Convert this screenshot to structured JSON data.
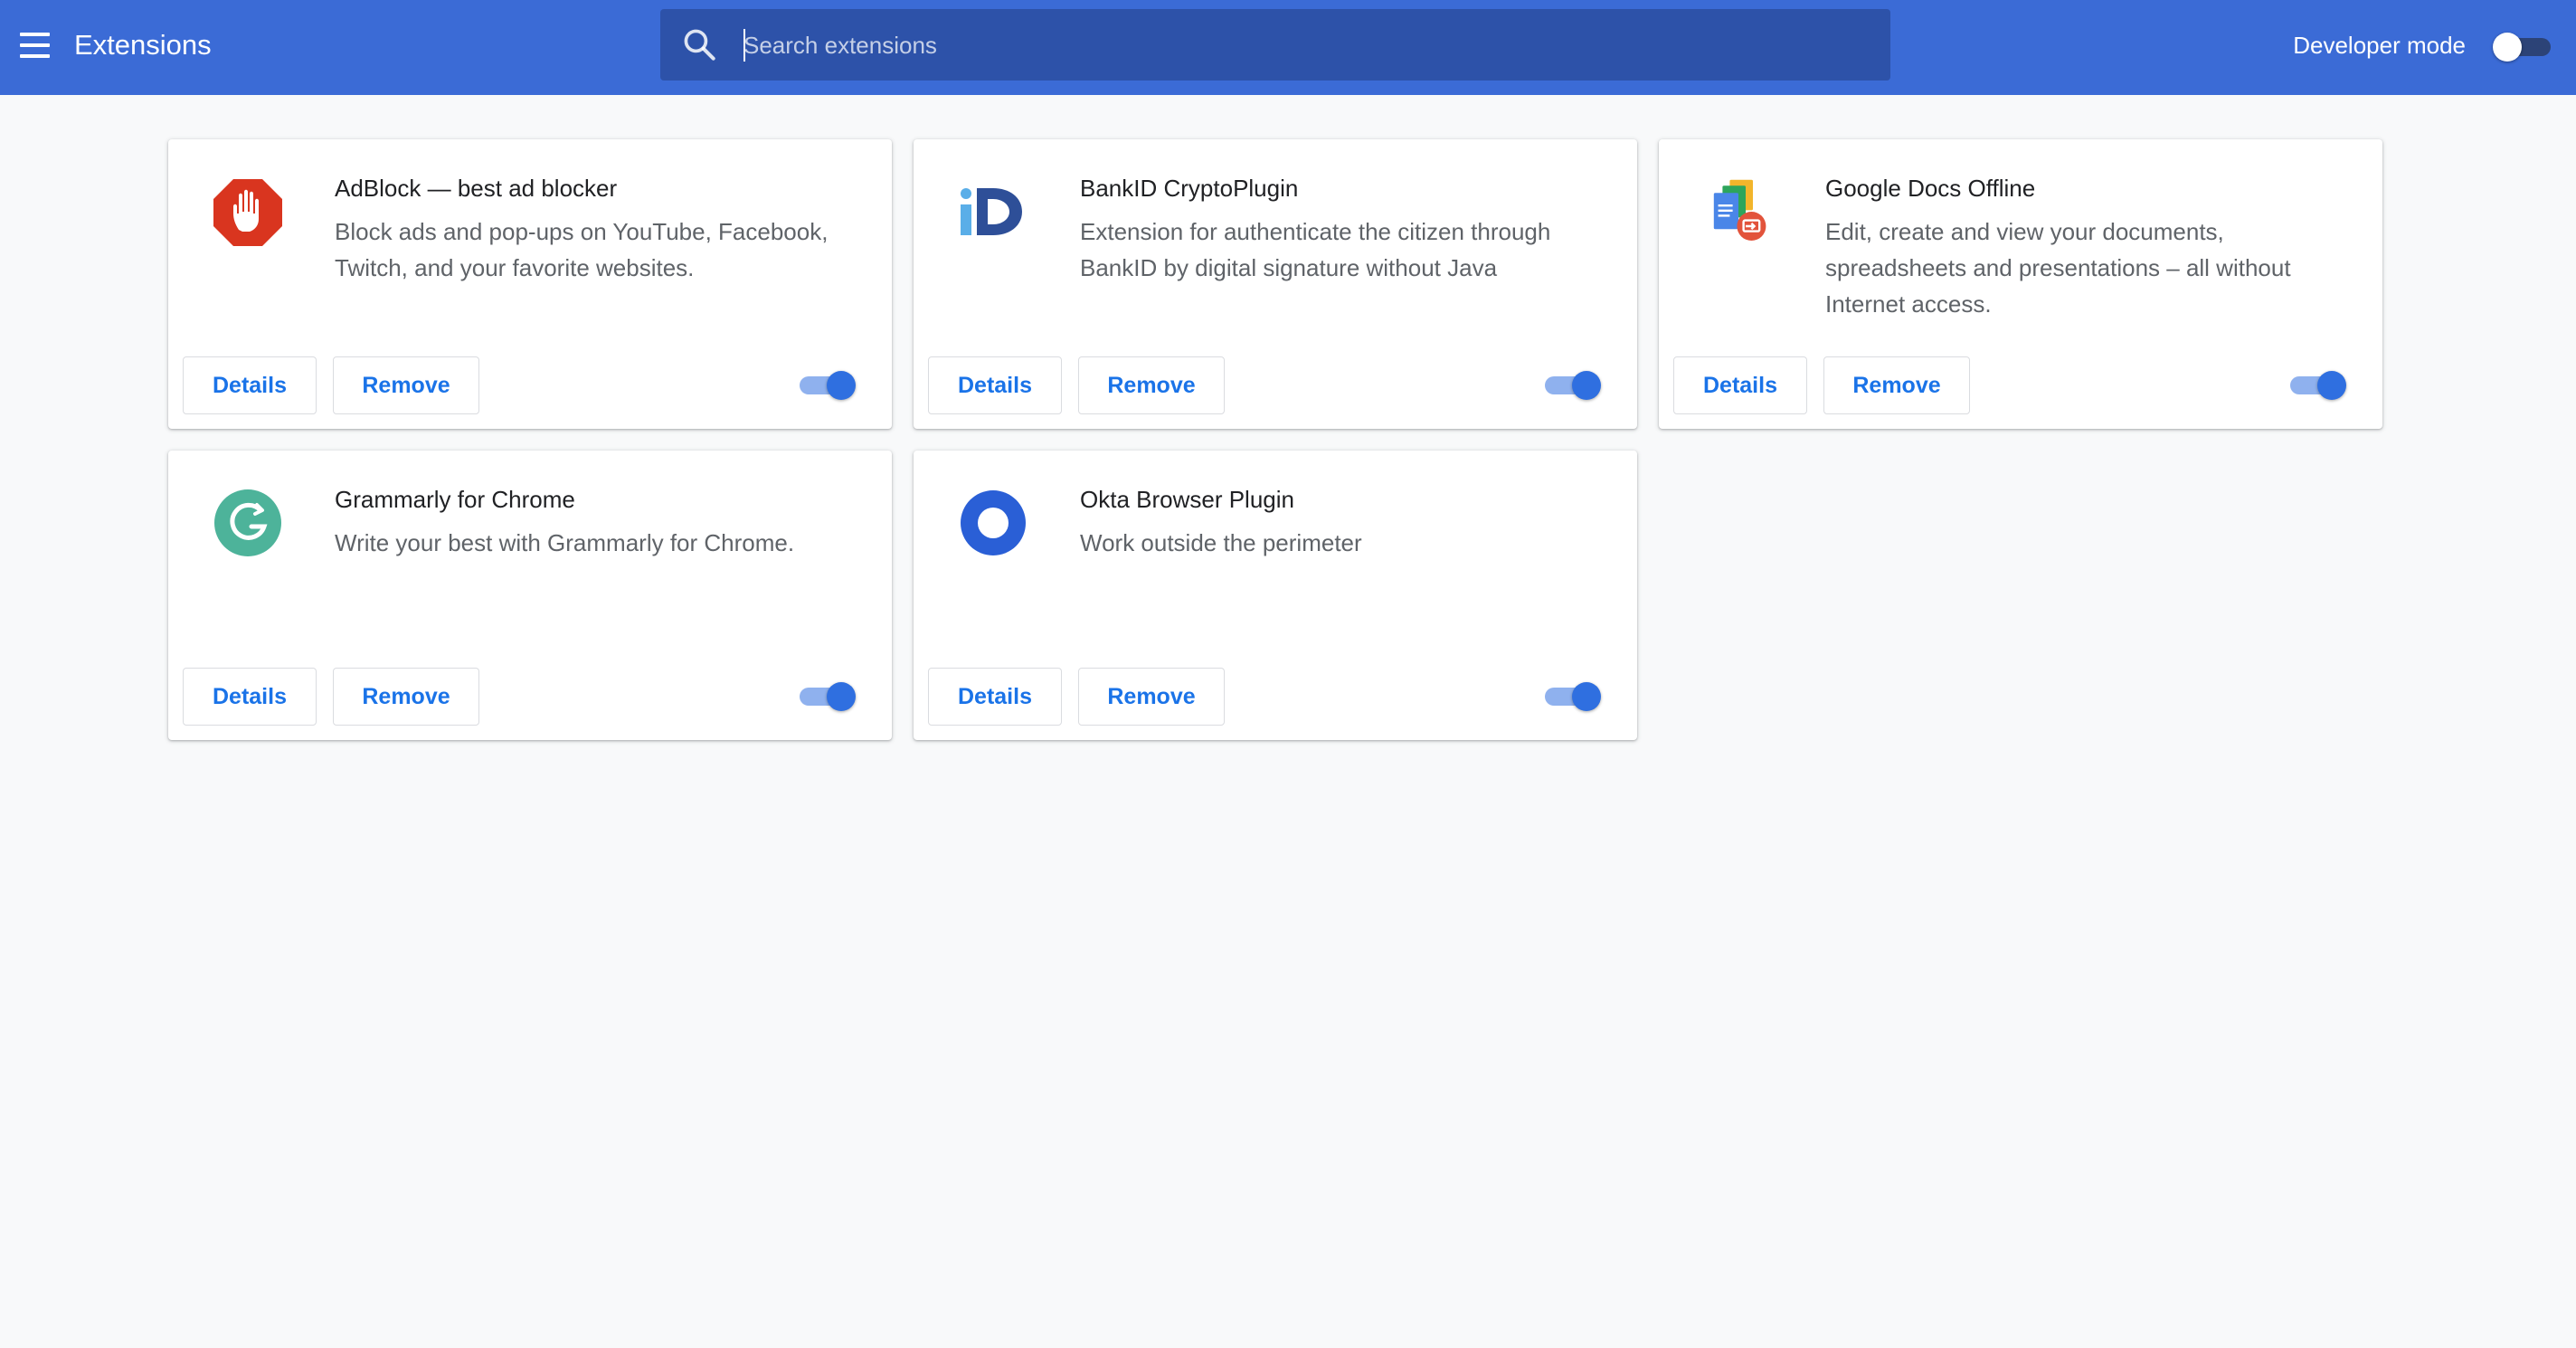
{
  "colors": {
    "toolbar": "#3b6bd6",
    "search_bg": "#2d52a9",
    "accent": "#1a73e8",
    "page_bg": "#f8f9fa",
    "toggle_on": "#2f6fe0"
  },
  "toolbar": {
    "menu_icon": "hamburger-menu-icon",
    "title": "Extensions",
    "search": {
      "icon": "search-icon",
      "placeholder": "Search extensions",
      "value": ""
    },
    "developer_mode": {
      "label": "Developer mode",
      "enabled": false
    }
  },
  "extensions": [
    {
      "name": "AdBlock — best ad blocker",
      "description": "Block ads and pop-ups on YouTube, Facebook, Twitch, and your favorite websites.",
      "icon": "adblock-hand-icon",
      "details_label": "Details",
      "remove_label": "Remove",
      "enabled": true
    },
    {
      "name": "BankID CryptoPlugin",
      "description": "Extension for authenticate the citizen through BankID by digital signature without Java",
      "icon": "bankid-icon",
      "details_label": "Details",
      "remove_label": "Remove",
      "enabled": true
    },
    {
      "name": "Google Docs Offline",
      "description": "Edit, create and view your documents, spreadsheets and presentations – all without Internet access.",
      "icon": "google-docs-offline-icon",
      "details_label": "Details",
      "remove_label": "Remove",
      "enabled": true
    },
    {
      "name": "Grammarly for Chrome",
      "description": "Write your best with Grammarly for Chrome.",
      "icon": "grammarly-icon",
      "details_label": "Details",
      "remove_label": "Remove",
      "enabled": true
    },
    {
      "name": "Okta Browser Plugin",
      "description": "Work outside the perimeter",
      "icon": "okta-icon",
      "details_label": "Details",
      "remove_label": "Remove",
      "enabled": true
    }
  ]
}
